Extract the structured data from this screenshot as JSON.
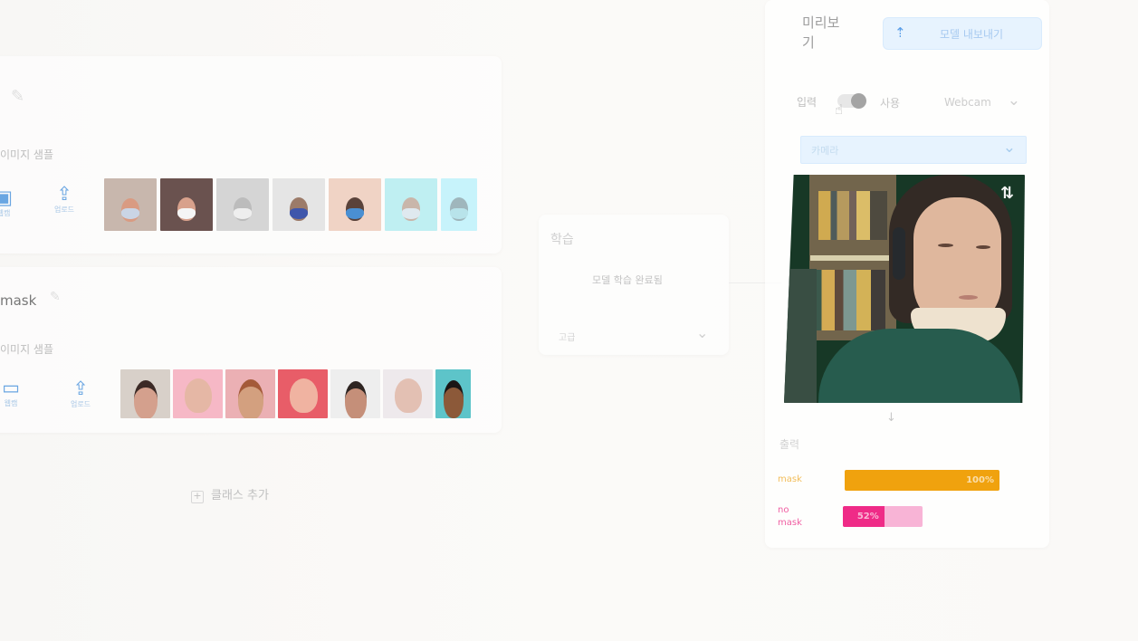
{
  "preview": {
    "title": "미리보기",
    "export_label": "모델 내보내기",
    "input_label": "입력",
    "input_state": "사용",
    "source_option": "Webcam",
    "camera_select_value": "카메라",
    "output_label": "출력"
  },
  "classes": [
    {
      "name": "",
      "samples_label": "이미지 샘플",
      "webcam_label": "웹캠",
      "upload_label": "업로드"
    },
    {
      "name": "mask",
      "samples_label": "이미지 샘플",
      "webcam_label": "웹캠",
      "upload_label": "업로드"
    }
  ],
  "add_class_label": "클래스 추가",
  "training": {
    "title": "학습",
    "button_label": "모델 학습 완료됨",
    "advanced_label": "고급"
  },
  "results": [
    {
      "name": "mask",
      "percent": 100,
      "display": "100%",
      "color": "#f0a20e",
      "track": "#fdf3e4"
    },
    {
      "name": "no mask",
      "percent": 52,
      "display": "52%",
      "color": "#ef2b87",
      "track": "#f8b4d6"
    }
  ],
  "colors": {
    "accent": "#3f8fe8",
    "soft_accent": "#d8ebff",
    "panel": "#ffffff"
  }
}
